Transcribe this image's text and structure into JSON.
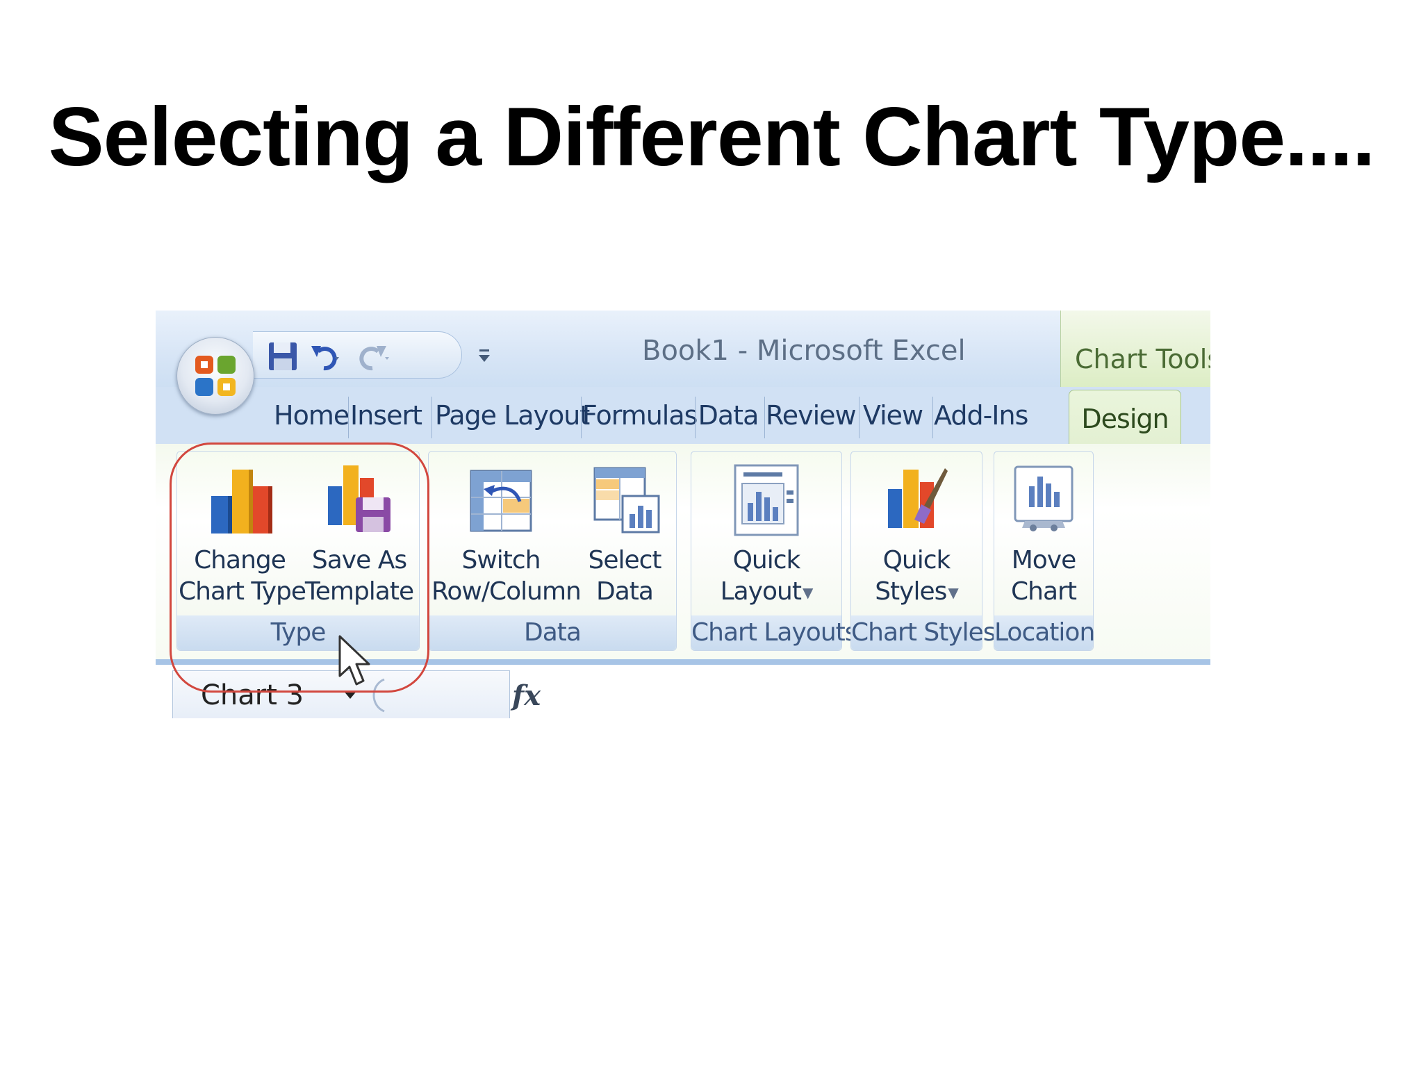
{
  "slide": {
    "title": "Selecting a Different Chart Type...."
  },
  "window": {
    "title": "Book1 - Microsoft Excel",
    "contextual_tab_group": "Chart Tools"
  },
  "tabs": [
    {
      "label": "Home",
      "active": false
    },
    {
      "label": "Insert",
      "active": false
    },
    {
      "label": "Page Layout",
      "active": false
    },
    {
      "label": "Formulas",
      "active": false
    },
    {
      "label": "Data",
      "active": false
    },
    {
      "label": "Review",
      "active": false
    },
    {
      "label": "View",
      "active": false
    },
    {
      "label": "Add-Ins",
      "active": false
    },
    {
      "label": "Design",
      "active": true
    }
  ],
  "ribbon": {
    "groups": {
      "type": {
        "label": "Type",
        "buttons": {
          "change_chart_type": {
            "line1": "Change",
            "line2": "Chart Type",
            "icon": "bar-chart-icon"
          },
          "save_as_template": {
            "line1": "Save As",
            "line2": "Template",
            "icon": "chart-save-icon"
          }
        }
      },
      "data": {
        "label": "Data",
        "buttons": {
          "switch_row_column": {
            "line1": "Switch",
            "line2": "Row/Column",
            "icon": "switch-grid-icon"
          },
          "select_data": {
            "line1": "Select",
            "line2": "Data",
            "icon": "select-data-icon"
          }
        }
      },
      "chart_layouts": {
        "label": "Chart Layouts",
        "buttons": {
          "quick_layout": {
            "line1": "Quick",
            "line2": "Layout",
            "icon": "layout-icon"
          }
        }
      },
      "chart_styles": {
        "label": "Chart Styles",
        "buttons": {
          "quick_styles": {
            "line1": "Quick",
            "line2": "Styles",
            "icon": "styles-brush-icon"
          }
        }
      },
      "location": {
        "label": "Location",
        "buttons": {
          "move_chart": {
            "line1": "Move",
            "line2": "Chart",
            "icon": "move-chart-icon"
          }
        }
      }
    }
  },
  "formula_bar": {
    "name_box": "Chart 3",
    "fx_label": "fx"
  },
  "colors": {
    "highlight": "#d2473e",
    "ribbon_border": "#a7c4e6",
    "design_tab": "#eaf5dc"
  }
}
